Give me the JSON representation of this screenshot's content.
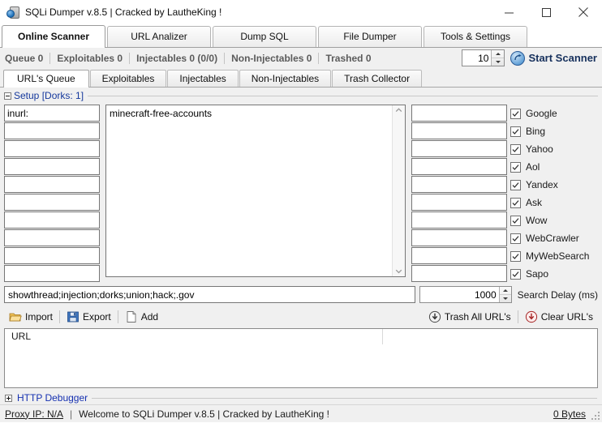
{
  "window": {
    "title": "SQLi Dumper v.8.5 | Cracked by LautheKing !",
    "icon": "app-icon",
    "minimize": "minimize-icon",
    "maximize": "maximize-icon",
    "close": "close-icon"
  },
  "main_tabs": [
    {
      "label": "Online Scanner",
      "active": true
    },
    {
      "label": "URL Analizer",
      "active": false
    },
    {
      "label": "Dump SQL",
      "active": false
    },
    {
      "label": "File Dumper",
      "active": false
    },
    {
      "label": "Tools & Settings",
      "active": false
    }
  ],
  "counters": [
    {
      "label": "Queue 0"
    },
    {
      "label": "Exploitables 0"
    },
    {
      "label": "Injectables 0 (0/0)"
    },
    {
      "label": "Non-Injectables 0"
    },
    {
      "label": "Trashed 0"
    }
  ],
  "threads": {
    "value": "10",
    "up_icon": "spinner-up-icon",
    "down_icon": "spinner-down-icon"
  },
  "start_scanner": {
    "label": "Start Scanner",
    "icon": "start-scanner-icon"
  },
  "sub_tabs": [
    {
      "label": "URL's Queue",
      "active": true
    },
    {
      "label": "Exploitables",
      "active": false
    },
    {
      "label": "Injectables",
      "active": false
    },
    {
      "label": "Non-Injectables",
      "active": false
    },
    {
      "label": "Trash Collector",
      "active": false
    }
  ],
  "setup": {
    "group_title": "Setup [Dorks: 1]",
    "collapsed": false,
    "collapse_icon": "collapse-minus-icon",
    "left_inputs": [
      "inurl:",
      "",
      "",
      "",
      "",
      "",
      "",
      "",
      "",
      ""
    ],
    "right_inputs": [
      "",
      "",
      "",
      "",
      "",
      "",
      "",
      "",
      "",
      ""
    ],
    "keywords": "minecraft-free-accounts",
    "scroll_up_icon": "scroll-up-icon",
    "scroll_down_icon": "scroll-down-icon",
    "engines": [
      {
        "label": "Google",
        "checked": true
      },
      {
        "label": "Bing",
        "checked": true
      },
      {
        "label": "Yahoo",
        "checked": true
      },
      {
        "label": "Aol",
        "checked": true
      },
      {
        "label": "Yandex",
        "checked": true
      },
      {
        "label": "Ask",
        "checked": true
      },
      {
        "label": "Wow",
        "checked": true
      },
      {
        "label": "WebCrawler",
        "checked": true
      },
      {
        "label": "MyWebSearch",
        "checked": true
      },
      {
        "label": "Sapo",
        "checked": true
      }
    ]
  },
  "filter": {
    "value": "showthread;injection;dorks;union;hack;.gov",
    "delay_value": "1000",
    "delay_label": "Search Delay (ms)"
  },
  "toolbar": {
    "import_label": "Import",
    "import_icon": "folder-open-icon",
    "export_label": "Export",
    "export_icon": "floppy-save-icon",
    "add_label": "Add",
    "add_icon": "new-page-icon",
    "trash_all_label": "Trash All URL's",
    "trash_all_icon": "down-arrow-circle-icon",
    "clear_label": "Clear URL's",
    "clear_icon": "down-arrow-circle-red-icon"
  },
  "url_list": {
    "columns": [
      "URL",
      ""
    ],
    "rows": []
  },
  "http_debugger": {
    "title": "HTTP Debugger",
    "collapse_icon": "expand-plus-icon"
  },
  "status": {
    "proxy": "Proxy IP: N/A",
    "separator": "|",
    "message": "Welcome to SQLi Dumper v.8.5 | Cracked by LautheKing !",
    "bytes": "0 Bytes",
    "grip": "resize-grip"
  },
  "colors": {
    "group_title": "#15389c",
    "counter_text": "#5b5b5b",
    "start_scanner_text": "#16305c",
    "debugger_title": "#1530b0",
    "window_bg": "#f0f0f0"
  }
}
